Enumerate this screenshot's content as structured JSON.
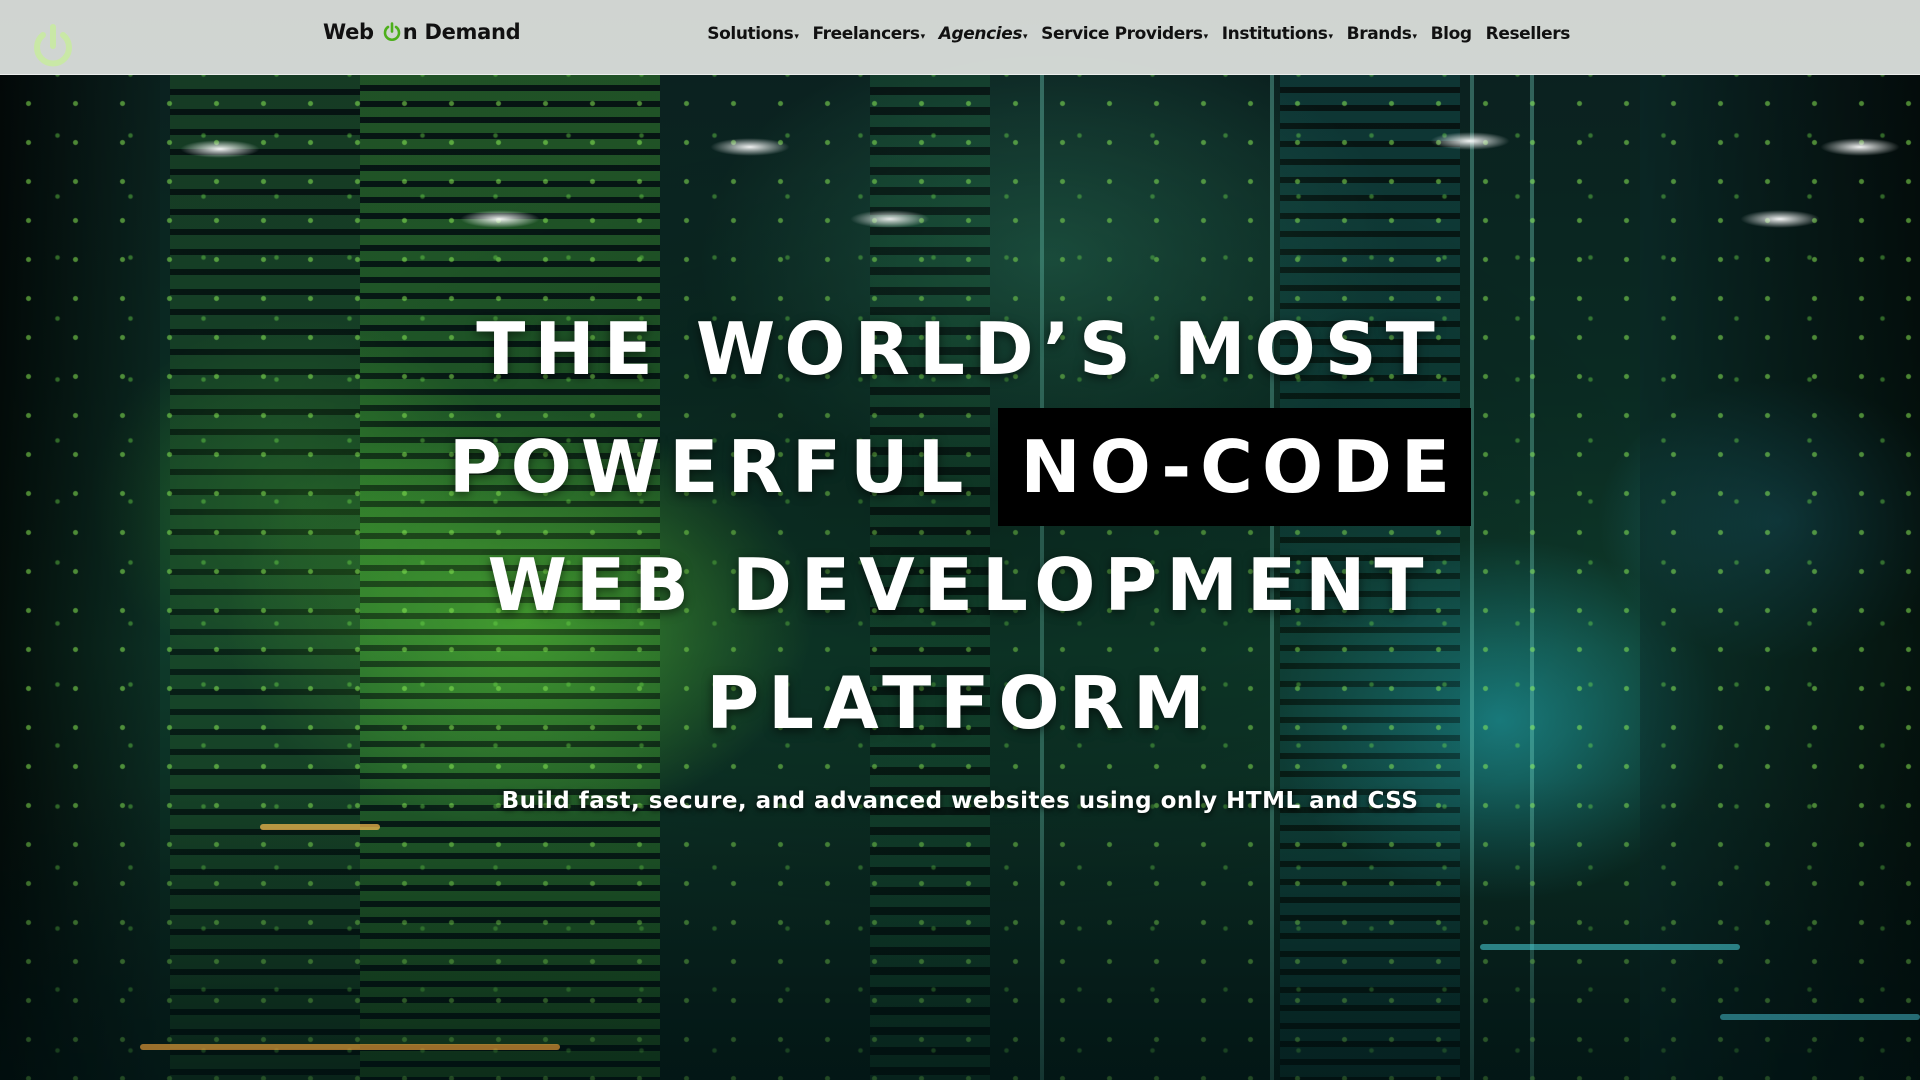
{
  "colors": {
    "header_bg": "#ecEEea",
    "accent_green": "#4caf1a",
    "hero_text": "#ffffff",
    "highlight_bg": "#000000"
  },
  "header": {
    "brand_icon": "power-icon",
    "logo": {
      "part1": "Web",
      "icon": "power-icon",
      "part2": "n Demand"
    },
    "nav": [
      {
        "label": "Solutions",
        "has_dropdown": true
      },
      {
        "label": "Freelancers",
        "has_dropdown": true
      },
      {
        "label": "Agencies",
        "has_dropdown": true
      },
      {
        "label": "Service Providers",
        "has_dropdown": true
      },
      {
        "label": "Institutions",
        "has_dropdown": true
      },
      {
        "label": "Brands",
        "has_dropdown": true
      },
      {
        "label": "Blog",
        "has_dropdown": false
      },
      {
        "label": "Resellers",
        "has_dropdown": false
      }
    ],
    "dropdown_caret": "▾"
  },
  "hero": {
    "line1": "THE WORLD’S MOST",
    "line2_plain": "POWERFUL",
    "line2_highlight": "NO-CODE",
    "line3": "WEB DEVELOPMENT",
    "line4": "PLATFORM",
    "subtitle": "Build fast, secure, and advanced websites using only HTML and CSS"
  }
}
